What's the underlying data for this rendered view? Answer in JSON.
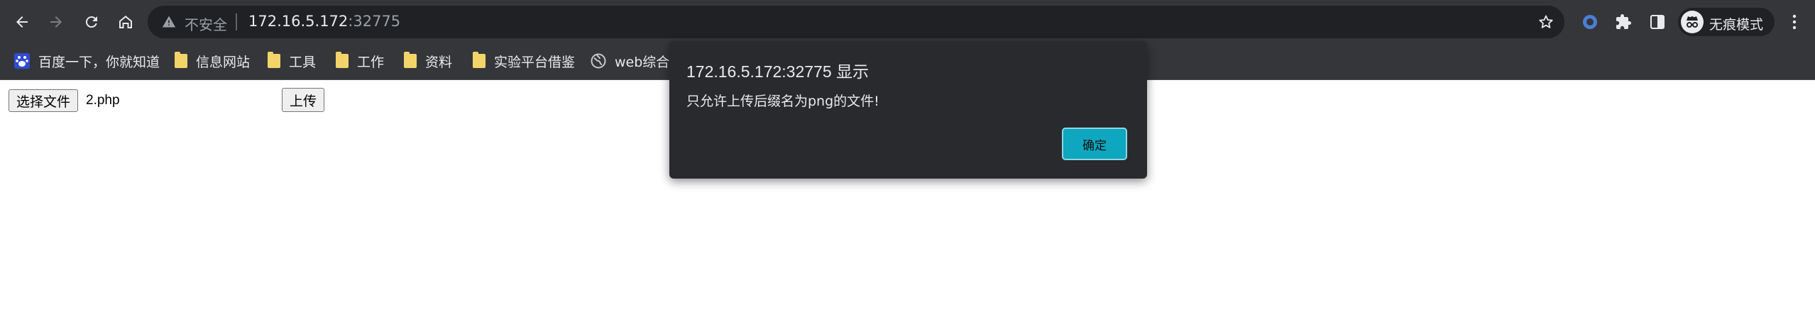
{
  "browser": {
    "omnibox": {
      "security_label": "不安全",
      "url_host": "172.16.5.172",
      "url_port": ":32775"
    },
    "profile": {
      "label": "无痕模式"
    },
    "bookmarks": [
      {
        "label": "百度一下，你就知道",
        "icon": "baidu-paw-icon"
      },
      {
        "label": "信息网站",
        "icon": "folder-icon"
      },
      {
        "label": "工具",
        "icon": "folder-icon"
      },
      {
        "label": "工作",
        "icon": "folder-icon"
      },
      {
        "label": "资料",
        "icon": "folder-icon"
      },
      {
        "label": "实验平台借鉴",
        "icon": "folder-icon"
      },
      {
        "label": "web综合",
        "icon": "globe-icon"
      }
    ],
    "colors": {
      "toolbar_bg": "#35363a",
      "omnibox_bg": "#202124",
      "dialog_bg": "#292a2d",
      "accent": "#0fa6bf"
    }
  },
  "page": {
    "choose_file_label": "选择文件",
    "selected_file": "2.php",
    "upload_label": "上传"
  },
  "dialog": {
    "title": "172.16.5.172:32775 显示",
    "message": "只允许上传后缀名为png的文件!",
    "ok_label": "确定"
  }
}
